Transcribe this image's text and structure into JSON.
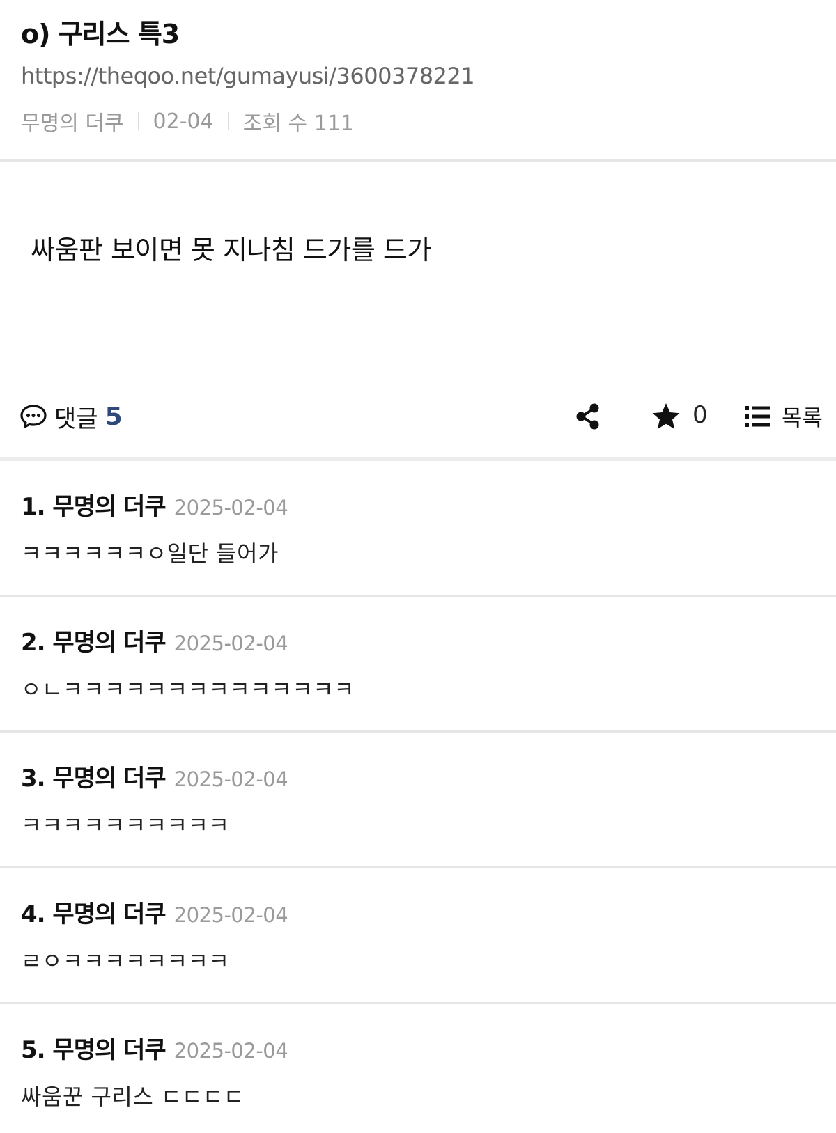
{
  "post": {
    "title": "o) 구리스 특3",
    "url": "https://theqoo.net/gumayusi/3600378221",
    "author": "무명의 더쿠",
    "date": "02-04",
    "views": "조회 수 111",
    "content": "싸움판 보이면 못 지나침 드가를 드가"
  },
  "toolbar": {
    "comment_icon": "speech-bubble-icon",
    "comment_label": "댓글",
    "comment_count": "5",
    "share_icon": "share-icon",
    "star_icon": "star-icon",
    "star_count": "0",
    "list_icon": "list-icon",
    "list_label": "목록"
  },
  "comments": [
    {
      "num_author": "1. 무명의 더쿠",
      "date": "2025-02-04",
      "text": "ㅋㅋㅋㅋㅋㅋㅇ일단 들어가"
    },
    {
      "num_author": "2. 무명의 더쿠",
      "date": "2025-02-04",
      "text": "ㅇㄴㅋㅋㅋㅋㅋㅋㅋㅋㅋㅋㅋㅋㅋㅋ"
    },
    {
      "num_author": "3. 무명의 더쿠",
      "date": "2025-02-04",
      "text": "ㅋㅋㅋㅋㅋㅋㅋㅋㅋㅋ"
    },
    {
      "num_author": "4. 무명의 더쿠",
      "date": "2025-02-04",
      "text": "ㄹㅇㅋㅋㅋㅋㅋㅋㅋㅋ"
    },
    {
      "num_author": "5. 무명의 더쿠",
      "date": "2025-02-04",
      "text": "싸움꾼 구리스 ㄷㄷㄷㄷ"
    }
  ]
}
